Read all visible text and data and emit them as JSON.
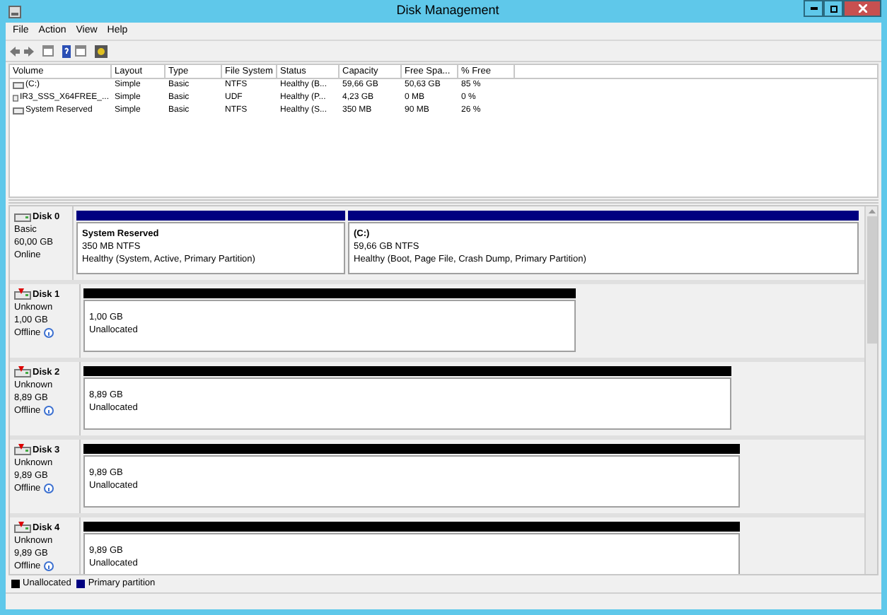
{
  "window": {
    "title": "Disk Management"
  },
  "menu": [
    "File",
    "Action",
    "View",
    "Help"
  ],
  "volume_table": {
    "columns": [
      "Volume",
      "Layout",
      "Type",
      "File System",
      "Status",
      "Capacity",
      "Free Spa...",
      "% Free"
    ],
    "rows": [
      {
        "kind": "disk",
        "cells": [
          "(C:)",
          "Simple",
          "Basic",
          "NTFS",
          "Healthy (B...",
          "59,66 GB",
          "50,63 GB",
          "85 %"
        ]
      },
      {
        "kind": "disc",
        "cells": [
          "IR3_SSS_X64FREE_...",
          "Simple",
          "Basic",
          "UDF",
          "Healthy (P...",
          "4,23 GB",
          "0 MB",
          "0 %"
        ]
      },
      {
        "kind": "disk",
        "cells": [
          "System Reserved",
          "Simple",
          "Basic",
          "NTFS",
          "Healthy (S...",
          "350 MB",
          "90 MB",
          "26 %"
        ]
      }
    ]
  },
  "disks": [
    {
      "name": "Disk 0",
      "type": "Basic",
      "size": "60,00 GB",
      "status": "Online",
      "online": true,
      "partitions": [
        {
          "kind": "primary",
          "name": "System Reserved",
          "size": "350 MB NTFS",
          "health": "Healthy (System, Active, Primary Partition)"
        },
        {
          "kind": "primary",
          "name": "(C:)",
          "size": "59,66 GB NTFS",
          "health": "Healthy (Boot, Page File, Crash Dump, Primary Partition)"
        }
      ]
    },
    {
      "name": "Disk 1",
      "type": "Unknown",
      "size": "1,00 GB",
      "status": "Offline",
      "online": false,
      "partitions": [
        {
          "kind": "unallocated",
          "size": "1,00 GB",
          "health": "Unallocated"
        }
      ]
    },
    {
      "name": "Disk 2",
      "type": "Unknown",
      "size": "8,89 GB",
      "status": "Offline",
      "online": false,
      "partitions": [
        {
          "kind": "unallocated",
          "size": "8,89 GB",
          "health": "Unallocated"
        }
      ]
    },
    {
      "name": "Disk 3",
      "type": "Unknown",
      "size": "9,89 GB",
      "status": "Offline",
      "online": false,
      "partitions": [
        {
          "kind": "unallocated",
          "size": "9,89 GB",
          "health": "Unallocated"
        }
      ]
    },
    {
      "name": "Disk 4",
      "type": "Unknown",
      "size": "9,89 GB",
      "status": "Offline",
      "online": false,
      "partitions": [
        {
          "kind": "unallocated",
          "size": "9,89 GB",
          "health": "Unallocated"
        }
      ]
    }
  ],
  "legend": [
    {
      "label": "Unallocated",
      "color": "#000000"
    },
    {
      "label": "Primary partition",
      "color": "#000080"
    }
  ]
}
